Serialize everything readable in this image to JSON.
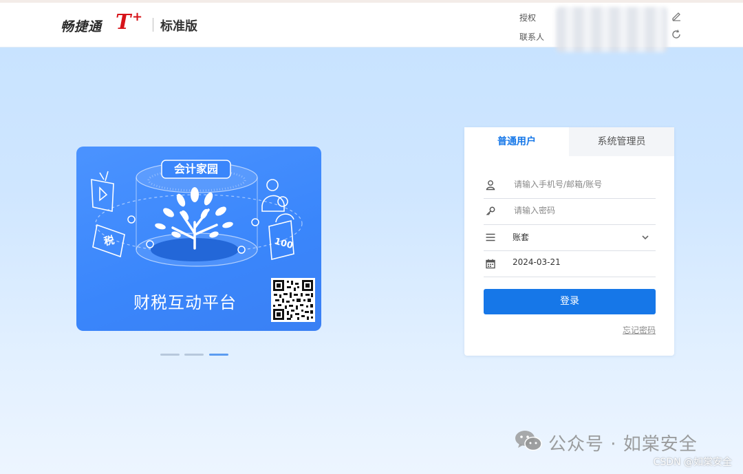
{
  "header": {
    "brand": "畅捷通",
    "brand_t": "T",
    "brand_plus": "+",
    "edition": "标准版",
    "auth_label": "授权",
    "contact_label": "联系人",
    "icons": [
      "edit-icon",
      "refresh-icon"
    ]
  },
  "banner": {
    "pill_text": "会计家园",
    "tax_text": "税",
    "caption": "财税互动平台",
    "carousel_dots": 3,
    "active_dot": 2
  },
  "login": {
    "tabs": [
      {
        "label": "普通用户",
        "active": true
      },
      {
        "label": "系统管理员",
        "active": false
      }
    ],
    "username_placeholder": "请输入手机号/邮箱/账号",
    "password_placeholder": "请输入密码",
    "account_set": "账套",
    "date": "2024-03-21",
    "submit_label": "登录",
    "forgot_label": "忘记密码"
  },
  "watermark": {
    "wechat_text": "公众号 · 如棠安全",
    "csdn_text": "CSDN @如棠安全"
  },
  "colors": {
    "accent": "#1677e8",
    "brand_red": "#d7141a",
    "banner_blue": "#3a86fb"
  }
}
